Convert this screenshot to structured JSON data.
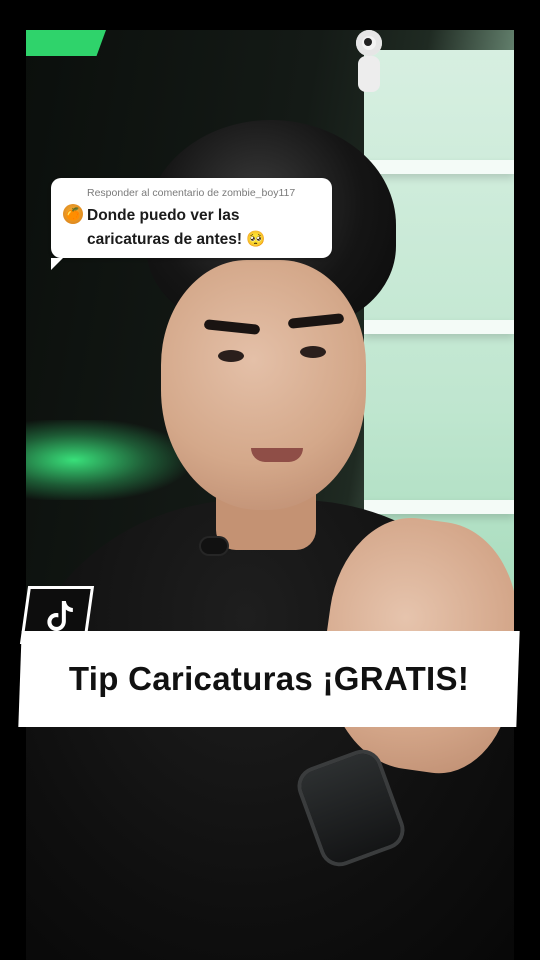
{
  "comment": {
    "reply_label": "Responder al comentario de zombie_boy117",
    "avatar_emoji": "🍊",
    "text": "Donde puedo ver las caricaturas de antes! 🥺"
  },
  "caption": {
    "text": "Tip Caricaturas ¡GRATIS!"
  },
  "badge": {
    "icon": "tiktok-icon"
  },
  "colors": {
    "accent_green": "#2fd36b",
    "caption_bg": "#ffffff",
    "caption_text": "#111111"
  }
}
